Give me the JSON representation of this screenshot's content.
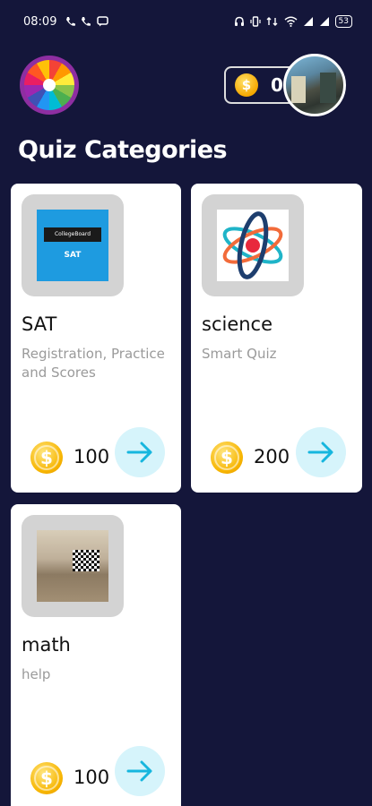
{
  "status_bar": {
    "time": "08:09",
    "left_icons": [
      "call-icon",
      "phone-icon",
      "message-icon"
    ],
    "right_icons": [
      "headset-icon",
      "vibrate-icon",
      "data-icon",
      "wifi-icon",
      "signal-icon",
      "signal-icon"
    ],
    "battery": "53"
  },
  "header": {
    "wheel_icon": "spin-wheel-icon",
    "coin_icon": "coin-icon",
    "coin_symbol": "$",
    "coin_count": "0",
    "avatar_icon": "avatar"
  },
  "page": {
    "title": "Quiz Categories"
  },
  "categories": [
    {
      "name": "SAT",
      "description": "Registration, Practice and Scores",
      "price": "100",
      "coin_symbol": "$",
      "thumb_logo": "CollegeBoard",
      "thumb_label": "SAT"
    },
    {
      "name": "science",
      "description": "Smart Quiz",
      "price": "200",
      "coin_symbol": "$"
    },
    {
      "name": "math",
      "description": "help",
      "price": "100",
      "coin_symbol": "$"
    }
  ],
  "colors": {
    "background": "#14163a",
    "card": "#ffffff",
    "arrow_button_bg": "#d6f4fb",
    "arrow": "#16b6de",
    "coin": "#f7b500",
    "thumb_bg": "#d3d3d3"
  }
}
